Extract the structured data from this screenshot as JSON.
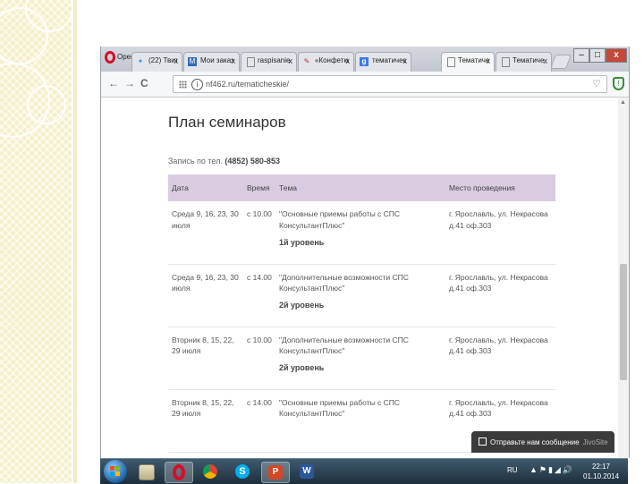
{
  "browser": {
    "app_name": "Opera",
    "tabs": [
      {
        "label": "(22) Твитте",
        "icon": "twitter-bird-icon",
        "active": false
      },
      {
        "label": "Мои заказы",
        "icon": "blue-square-icon",
        "active": false
      },
      {
        "label": "raspisanie",
        "icon": "page-icon",
        "active": false
      },
      {
        "label": "«Конфетки",
        "icon": "pencil-icon",
        "active": false
      },
      {
        "label": "тематическ",
        "icon": "google-g-icon",
        "active": false
      },
      {
        "label": "Тематиче",
        "icon": "page-icon",
        "active": true
      },
      {
        "label": "Тематиче",
        "icon": "page-icon",
        "active": false
      }
    ],
    "tab_close": "x",
    "address": {
      "url": "nf462.ru/tematicheskie/"
    },
    "controls": {
      "minimize": "–",
      "maximize": "□",
      "close": "x"
    }
  },
  "page": {
    "title": "План семинаров",
    "signup_prefix": "Запись по тел. ",
    "signup_phone": "(4852) 580-853",
    "table": {
      "headers": [
        "Дата",
        "Время",
        "Тема",
        "Место проведения"
      ],
      "rows": [
        {
          "date": "Среда 9, 16, 23, 30 июля",
          "time": "с 10.00",
          "topic": "\"Основные приемы работы с СПС КонсультантПлюс\"",
          "level": "1й уровень",
          "place": "г. Ярославль, ул. Некрасова д.41 оф.303"
        },
        {
          "date": "Среда 9, 16, 23, 30 июля",
          "time": "с 14.00",
          "topic": "\"Дополнительные возможности СПС КонсультантПлюс\"",
          "level": "2й уровень",
          "place": "г. Ярославль, ул. Некрасова д.41 оф.303"
        },
        {
          "date": "Вторник 8, 15, 22, 29 июля",
          "time": "с 10.00",
          "topic": "\"Дополнительные возможности СПС КонсультантПлюс\"",
          "level": "2й уровень",
          "place": "г. Ярославль, ул. Некрасова д.41 оф.303"
        },
        {
          "date": "Вторник 8, 15, 22, 29 июля",
          "time": "с 14.00",
          "topic": "\"Основные приемы работы с СПС КонсультантПлюс\"",
          "level": "",
          "place": "г. Ярославль, ул. Некрасова д.41 оф.303"
        }
      ]
    }
  },
  "chat_widget": {
    "label": "Отправьте нам сообщение",
    "brand": "JivoSite"
  },
  "taskbar": {
    "icons": [
      "windows-start-icon",
      "file-manager-icon",
      "opera-icon",
      "chrome-icon",
      "skype-icon",
      "powerpoint-icon",
      "word-icon"
    ],
    "language": "RU",
    "time": "22:17",
    "date": "01.10.2014"
  }
}
